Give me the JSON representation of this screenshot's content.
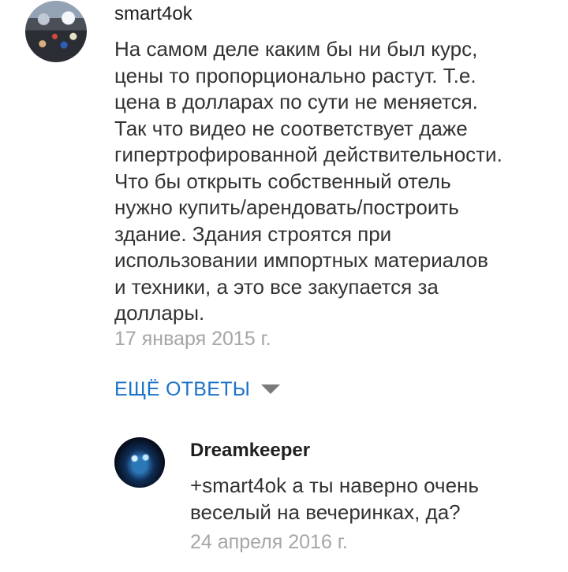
{
  "comments": [
    {
      "author": "smart4ok",
      "text": "На самом деле каким бы ни был курс,\nцены то пропорционально растут. Т.е.\nцена в долларах по сути не меняется.\nТак что видео не соответствует даже\nгипертрофированной действительности.\nЧто бы открыть собственный отель\nнужно купить/арендовать/построить\nздание. Здания строятся при\nиспользовании импортных материалов\nи техники, а это все закупается за\nдоллары.",
      "date": "17 января 2015 г."
    }
  ],
  "more_replies": {
    "label": "ЕЩЁ ОТВЕТЫ",
    "icon": "caret-down-icon",
    "color": "#1a73c8"
  },
  "replies": [
    {
      "author": "Dreamkeeper",
      "text": "+smart4ok а ты наверно очень\nвеселый на вечеринках, да?",
      "date": "24 апреля 2016 г."
    }
  ],
  "colors": {
    "text": "#333333",
    "author": "#1f1f1f",
    "meta": "#a6a6a6",
    "link": "#1a73c8"
  }
}
